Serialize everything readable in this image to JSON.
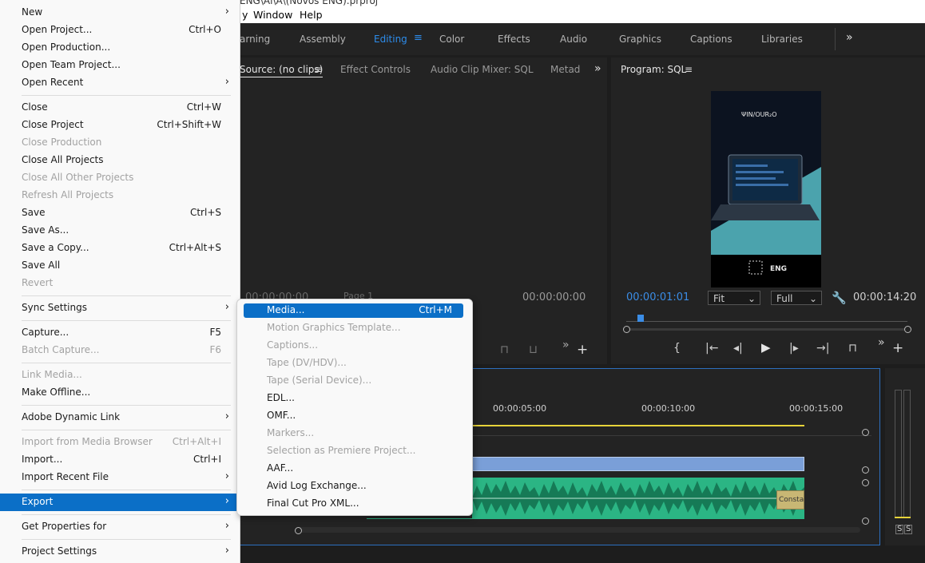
{
  "window_title": "ENG\\Ai\\A\\(Novos ENG).prproj",
  "menubar": {
    "window_label": "Window",
    "help_label": "Help",
    "partial_label": "y"
  },
  "workspaces": [
    {
      "label": "arning"
    },
    {
      "label": "Assembly"
    },
    {
      "label": "Editing",
      "active": true
    },
    {
      "label": "Color"
    },
    {
      "label": "Effects"
    },
    {
      "label": "Audio"
    },
    {
      "label": "Graphics"
    },
    {
      "label": "Captions"
    },
    {
      "label": "Libraries"
    }
  ],
  "source_panel": {
    "tabs": [
      {
        "label": "Source: (no clips)"
      },
      {
        "label": "Effect Controls"
      },
      {
        "label": "Audio Clip Mixer: SQL"
      },
      {
        "label": "Metad"
      }
    ],
    "timecode_left": "00:00:00:00",
    "timecode_right": "00:00:00:00",
    "page_label": "Page 1"
  },
  "program_panel": {
    "title": "Program: SQL",
    "timecode_current": "00:00:01:01",
    "timecode_duration": "00:00:14:20",
    "fit_value": "Fit",
    "quality_value": "Full",
    "video_brand_text": "ENG"
  },
  "timeline": {
    "ruler_labels": [
      "00:00:05:00",
      "00:00:10:00",
      "00:00:15:00"
    ],
    "clip_label": "Consta",
    "meter_solo": [
      "S",
      "S"
    ]
  },
  "file_menu": {
    "items": [
      {
        "label": "New",
        "arrow": true
      },
      {
        "label": "Open Project...",
        "shortcut": "Ctrl+O"
      },
      {
        "label": "Open Production..."
      },
      {
        "label": "Open Team Project..."
      },
      {
        "label": "Open Recent",
        "arrow": true
      },
      {
        "sep": true
      },
      {
        "label": "Close",
        "shortcut": "Ctrl+W"
      },
      {
        "label": "Close Project",
        "shortcut": "Ctrl+Shift+W"
      },
      {
        "label": "Close Production",
        "disabled": true
      },
      {
        "label": "Close All Projects"
      },
      {
        "label": "Close All Other Projects",
        "disabled": true
      },
      {
        "label": "Refresh All Projects",
        "disabled": true
      },
      {
        "label": "Save",
        "shortcut": "Ctrl+S"
      },
      {
        "label": "Save As..."
      },
      {
        "label": "Save a Copy...",
        "shortcut": "Ctrl+Alt+S"
      },
      {
        "label": "Save All"
      },
      {
        "label": "Revert",
        "disabled": true
      },
      {
        "sep": true
      },
      {
        "label": "Sync Settings",
        "arrow": true
      },
      {
        "sep": true
      },
      {
        "label": "Capture...",
        "shortcut": "F5"
      },
      {
        "label": "Batch Capture...",
        "shortcut": "F6",
        "disabled": true
      },
      {
        "sep": true
      },
      {
        "label": "Link Media...",
        "disabled": true
      },
      {
        "label": "Make Offline..."
      },
      {
        "sep": true
      },
      {
        "label": "Adobe Dynamic Link",
        "arrow": true
      },
      {
        "sep": true
      },
      {
        "label": "Import from Media Browser",
        "shortcut": "Ctrl+Alt+I",
        "disabled": true
      },
      {
        "label": "Import...",
        "shortcut": "Ctrl+I"
      },
      {
        "label": "Import Recent File",
        "arrow": true
      },
      {
        "sep": true
      },
      {
        "label": "Export",
        "arrow": true,
        "highlighted": true
      },
      {
        "sep": true
      },
      {
        "label": "Get Properties for",
        "arrow": true
      },
      {
        "sep": true
      },
      {
        "label": "Project Settings",
        "arrow": true
      }
    ]
  },
  "export_submenu": {
    "items": [
      {
        "label": "Media...",
        "shortcut": "Ctrl+M",
        "highlighted": true
      },
      {
        "label": "Motion Graphics Template...",
        "disabled": true
      },
      {
        "label": "Captions...",
        "disabled": true
      },
      {
        "label": "Tape (DV/HDV)...",
        "disabled": true
      },
      {
        "label": "Tape (Serial Device)...",
        "disabled": true
      },
      {
        "label": "EDL..."
      },
      {
        "label": "OMF..."
      },
      {
        "label": "Markers...",
        "disabled": true
      },
      {
        "label": "Selection as Premiere Project...",
        "disabled": true
      },
      {
        "label": "AAF..."
      },
      {
        "label": "Avid Log Exchange..."
      },
      {
        "label": "Final Cut Pro XML..."
      }
    ]
  }
}
